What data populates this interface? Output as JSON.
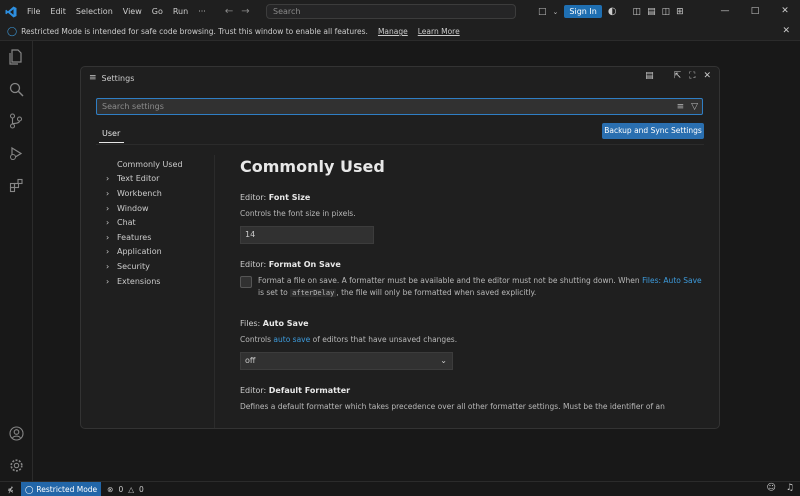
{
  "titlebar": {
    "menu": [
      "File",
      "Edit",
      "Selection",
      "View",
      "Go",
      "Run",
      "···"
    ],
    "search_placeholder": "Search",
    "signin_label": "Sign In"
  },
  "banner": {
    "message": "Restricted Mode is intended for safe code browsing. Trust this window to enable all features.",
    "manage_label": "Manage",
    "learn_more_label": "Learn More"
  },
  "settings": {
    "title": "Settings",
    "search_placeholder": "Search settings",
    "tab_user": "User",
    "sync_button": "Backup and Sync Settings",
    "toc": [
      "Commonly Used",
      "Text Editor",
      "Workbench",
      "Window",
      "Chat",
      "Features",
      "Application",
      "Security",
      "Extensions"
    ],
    "heading": "Commonly Used",
    "font_size": {
      "prefix": "Editor: ",
      "name": "Font Size",
      "desc": "Controls the font size in pixels.",
      "value": "14"
    },
    "format_on_save": {
      "prefix": "Editor: ",
      "name": "Format On Save",
      "desc_part1": "Format a file on save. A formatter must be available and the editor must not be shutting down. When ",
      "desc_link": "Files: Auto Save",
      "desc_part2": " is set to ",
      "desc_code": "afterDelay",
      "desc_part3": ", the file will only be formatted when saved explicitly."
    },
    "auto_save": {
      "prefix": "Files: ",
      "name": "Auto Save",
      "desc_part1": "Controls ",
      "desc_link": "auto save",
      "desc_part2": " of editors that have unsaved changes.",
      "value": "off"
    },
    "default_formatter": {
      "prefix": "Editor: ",
      "name": "Default Formatter",
      "desc": "Defines a default formatter which takes precedence over all other formatter settings. Must be the identifier of an"
    }
  },
  "status": {
    "restricted_label": "Restricted Mode",
    "errors": "0",
    "warnings": "0"
  },
  "colors": {
    "accent": "#2a6fb0",
    "link": "#3d9bdc",
    "background": "#1f1f1f"
  }
}
